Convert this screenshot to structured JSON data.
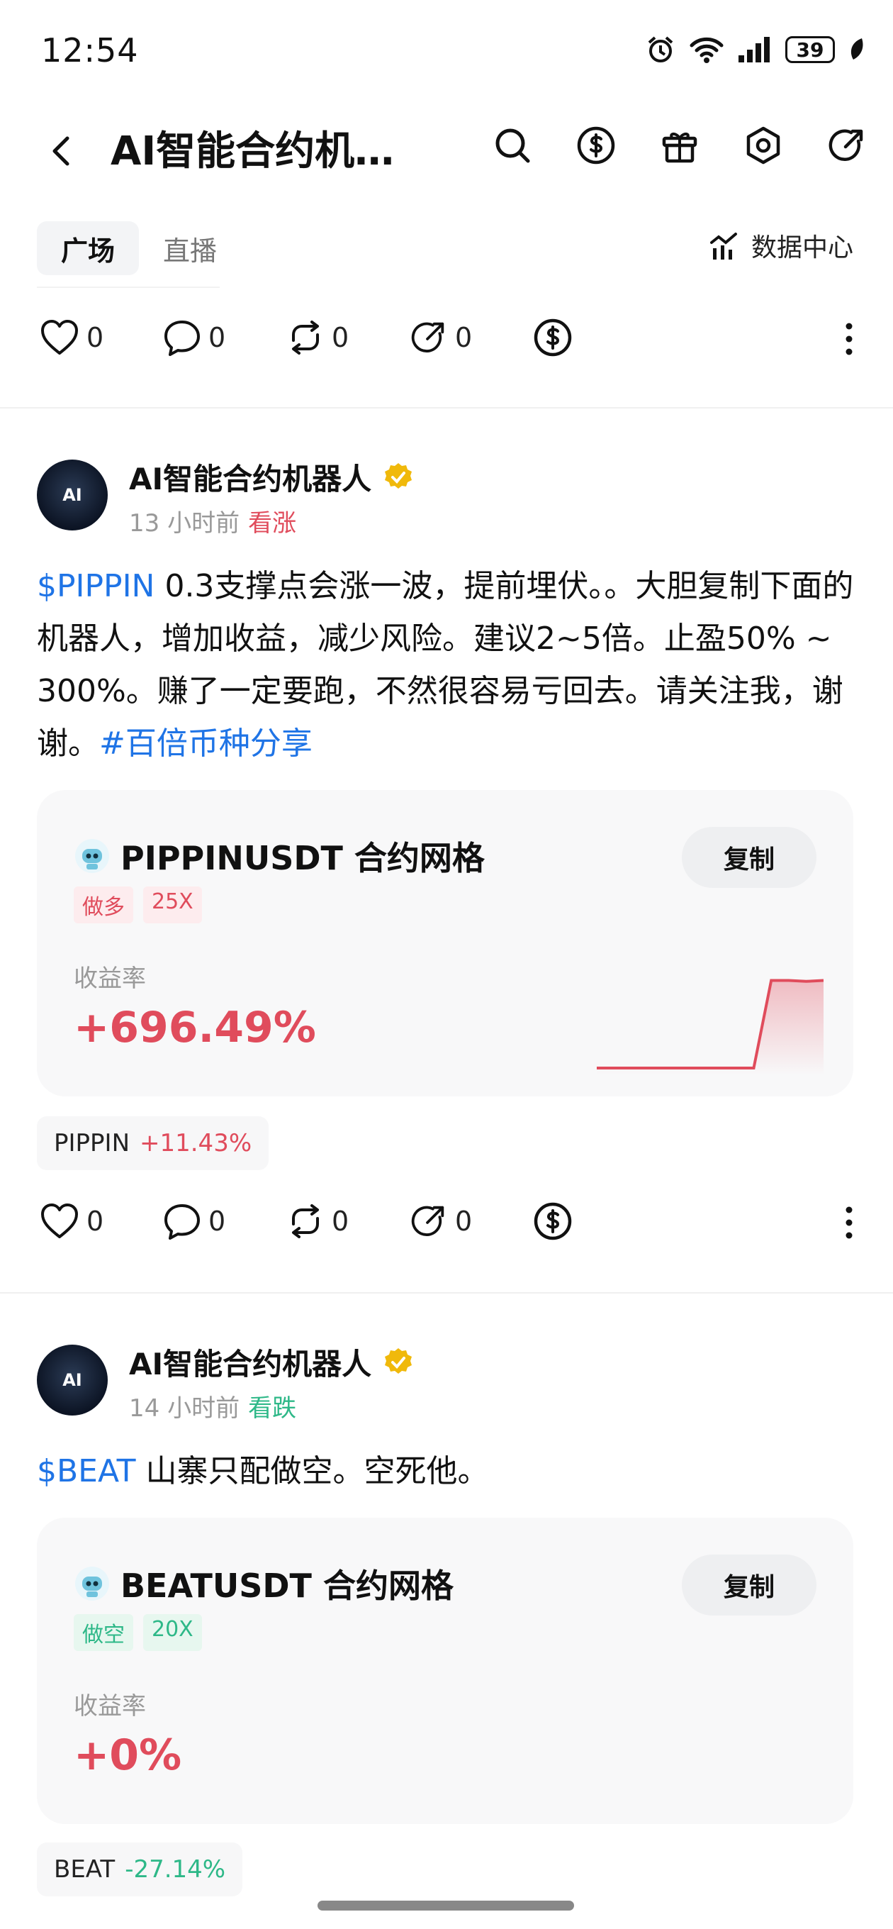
{
  "status": {
    "time": "12:54",
    "battery": "39"
  },
  "nav": {
    "title": "AI智能合约机…"
  },
  "tabs": [
    "广场",
    "直播"
  ],
  "data_center": "数据中心",
  "top_actions": {
    "like": "0",
    "comment": "0",
    "repost": "0",
    "share": "0"
  },
  "posts": [
    {
      "author": "AI智能合约机器人",
      "avatar_text": "AI",
      "time": "13 小时前",
      "sentiment": "看涨",
      "cashtag": "$PIPPIN",
      "text": " 0.3支撑点会涨一波，提前埋伏。。大胆复制下面的机器人，增加收益，减少风险。建议2~5倍。止盈50% ~ 300%。赚了一定要跑，不然很容易亏回去。请关注我，谢谢。",
      "hashtag": "#百倍币种分享",
      "card": {
        "name": "PIPPINUSDT 合约网格",
        "copy": "复制",
        "side": "做多",
        "leverage": "25X",
        "yield_label": "收益率",
        "yield": "+696.49%",
        "sparkline": [
          0,
          0,
          0,
          0,
          0,
          0,
          0,
          0,
          0,
          0,
          0.95,
          0.95,
          0.94,
          0.95
        ]
      },
      "ticker": {
        "symbol": "PIPPIN",
        "change": "+11.43%"
      },
      "actions": {
        "like": "0",
        "comment": "0",
        "repost": "0",
        "share": "0"
      }
    },
    {
      "author": "AI智能合约机器人",
      "avatar_text": "AI",
      "time": "14 小时前",
      "sentiment": "看跌",
      "cashtag": "$BEAT",
      "text": " 山寨只配做空。空死他。",
      "card": {
        "name": "BEATUSDT 合约网格",
        "copy": "复制",
        "side": "做空",
        "leverage": "20X",
        "yield_label": "收益率",
        "yield": "+0%"
      },
      "ticker": {
        "symbol": "BEAT",
        "change": "-27.14%"
      }
    }
  ]
}
